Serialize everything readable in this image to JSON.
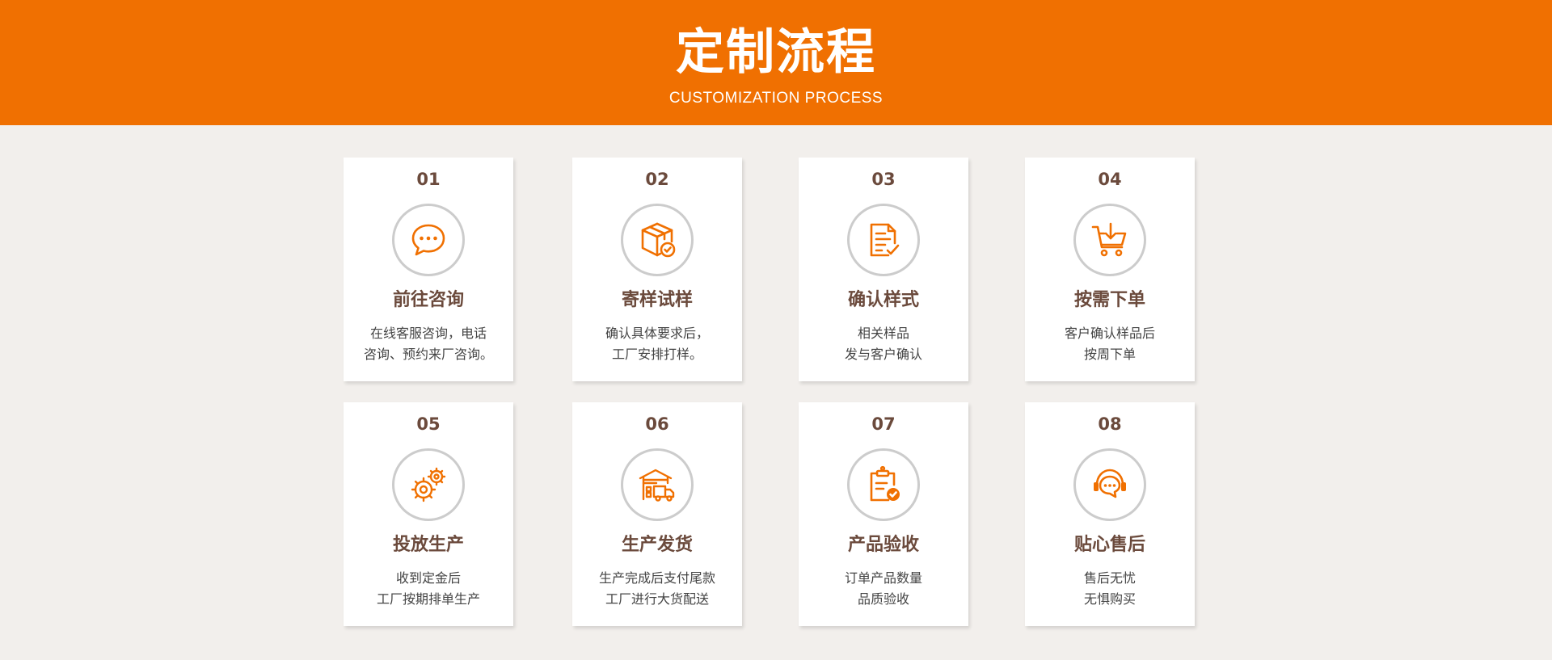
{
  "header": {
    "title": "定制流程",
    "subtitle": "CUSTOMIZATION PROCESS"
  },
  "colors": {
    "accent": "#f07001",
    "text_dark": "#6b4a3c",
    "background": "#f2efec"
  },
  "steps": [
    {
      "number": "01",
      "icon": "chat-bubble-icon",
      "title": "前往咨询",
      "desc": [
        "在线客服咨询，电话",
        "咨询、预约来厂咨询。"
      ]
    },
    {
      "number": "02",
      "icon": "package-check-icon",
      "title": "寄样试样",
      "desc": [
        "确认具体要求后，",
        "工厂安排打样。"
      ]
    },
    {
      "number": "03",
      "icon": "document-check-icon",
      "title": "确认样式",
      "desc": [
        "相关样品",
        "发与客户确认"
      ]
    },
    {
      "number": "04",
      "icon": "cart-download-icon",
      "title": "按需下单",
      "desc": [
        "客户确认样品后",
        "按周下单"
      ]
    },
    {
      "number": "05",
      "icon": "gears-icon",
      "title": "投放生产",
      "desc": [
        "收到定金后",
        "工厂按期排单生产"
      ]
    },
    {
      "number": "06",
      "icon": "warehouse-truck-icon",
      "title": "生产发货",
      "desc": [
        "生产完成后支付尾款",
        "工厂进行大货配送"
      ]
    },
    {
      "number": "07",
      "icon": "clipboard-check-icon",
      "title": "产品验收",
      "desc": [
        "订单产品数量",
        "品质验收"
      ]
    },
    {
      "number": "08",
      "icon": "headset-support-icon",
      "title": "贴心售后",
      "desc": [
        "售后无忧",
        "无惧购买"
      ]
    }
  ]
}
